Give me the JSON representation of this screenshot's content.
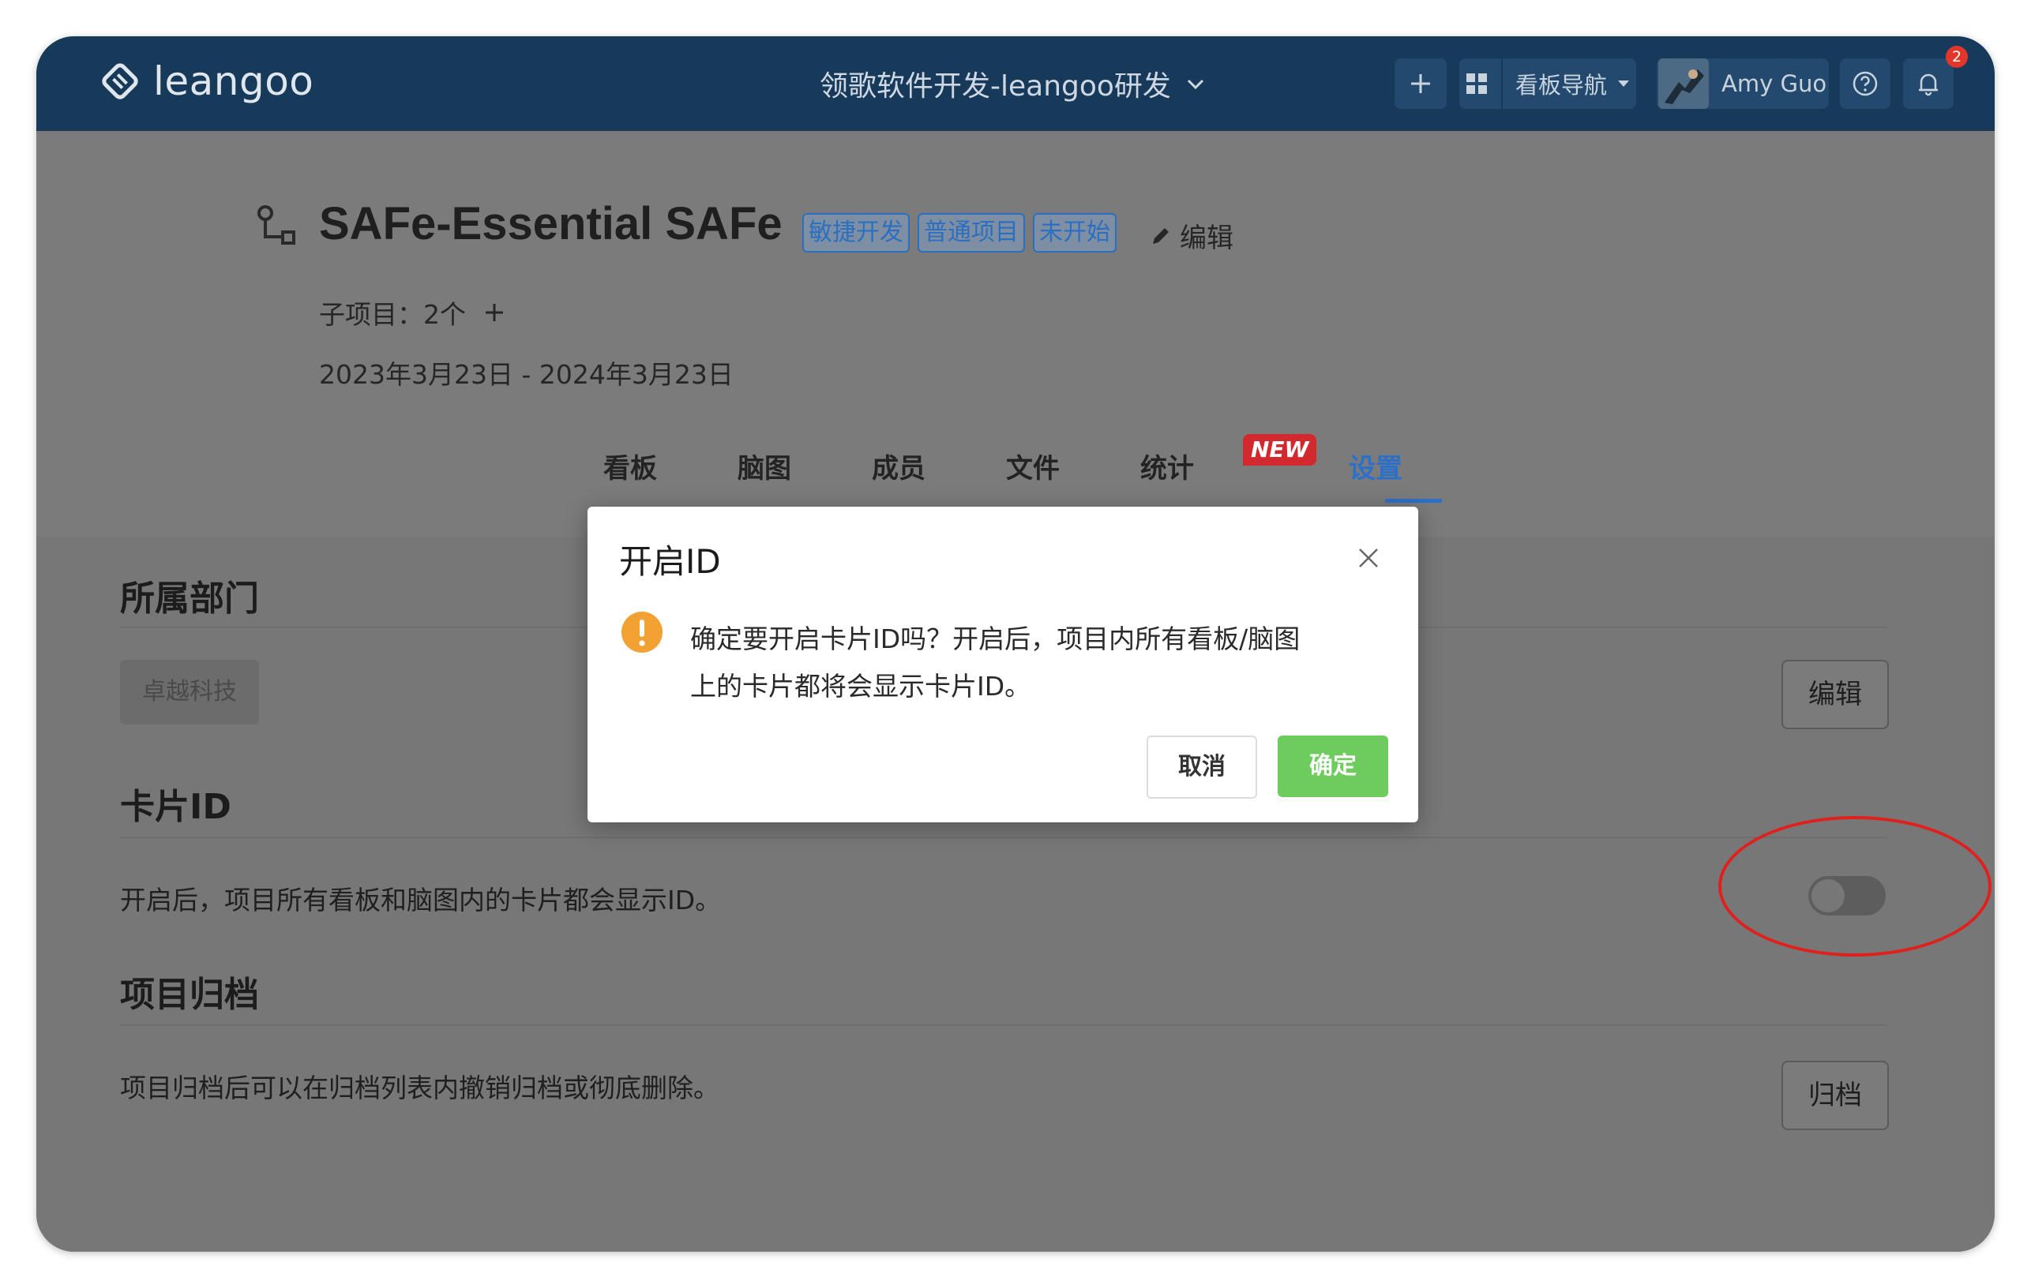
{
  "topbar": {
    "logo_text": "leangoo",
    "project_switch": "领歌软件开发-leangoo研发",
    "add_icon": "plus-icon",
    "board_nav_label": "看板导航",
    "user_name": "Amy Guo",
    "help_icon": "question-circle-icon",
    "notification_count": "2"
  },
  "project": {
    "title": "SAFe-Essential SAFe",
    "tags": [
      "敏捷开发",
      "普通项目",
      "未开始"
    ],
    "edit_label": "编辑",
    "subprojects": "子项目：2个",
    "dates": "2023年3月23日 - 2024年3月23日"
  },
  "tabs": [
    {
      "label": "看板"
    },
    {
      "label": "脑图"
    },
    {
      "label": "成员"
    },
    {
      "label": "文件"
    },
    {
      "label": "统计"
    },
    {
      "label": "设置"
    }
  ],
  "new_badge": "NEW",
  "sections": {
    "dept": {
      "title": "所属部门",
      "chip": "卓越科技",
      "button": "编辑"
    },
    "card_id": {
      "title": "卡片ID",
      "desc": "开启后，项目所有看板和脑图内的卡片都会显示ID。",
      "enabled": false
    },
    "archive": {
      "title": "项目归档",
      "desc": "项目归档后可以在归档列表内撤销归档或彻底删除。",
      "button": "归档"
    }
  },
  "modal": {
    "title": "开启ID",
    "line1": "确定要开启卡片ID吗？开启后，项目内所有看板/脑图",
    "line2": "上的卡片都将会显示卡片ID。",
    "cancel": "取消",
    "confirm": "确定"
  },
  "colors": {
    "topbar": "#173a5a",
    "accent": "#2c70c9",
    "confirm": "#6ecc5e",
    "highlight": "#e0201c"
  }
}
